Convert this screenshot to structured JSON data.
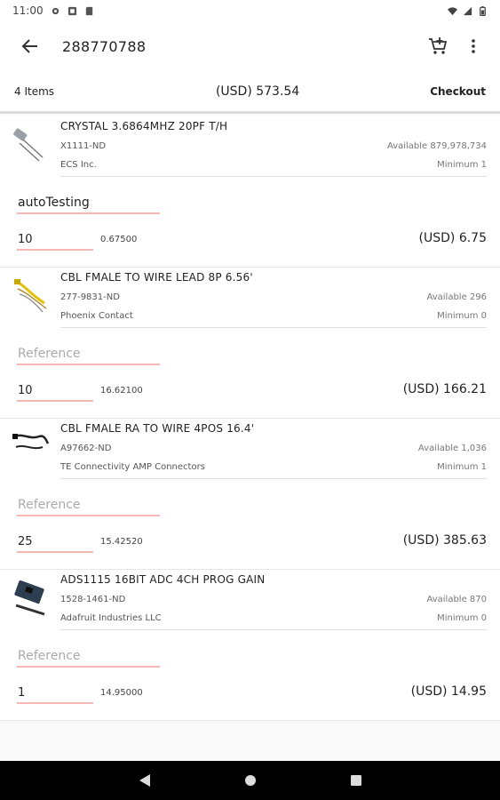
{
  "status": {
    "time": "11:00"
  },
  "app_bar": {
    "title": "288770788"
  },
  "summary": {
    "count": "4 Items",
    "total": "(USD) 573.54",
    "checkout_label": "Checkout"
  },
  "items": [
    {
      "name": "CRYSTAL 3.6864MHZ 20PF T/H",
      "part_number": "X1111-ND",
      "manufacturer": "ECS Inc.",
      "available": "Available 879,978,734",
      "minimum": "Minimum 1",
      "reference_value": "autoTesting",
      "reference_placeholder": "Reference",
      "quantity": "10",
      "unit_price": "0.67500",
      "extended_price": "(USD) 6.75",
      "thumb_icon": "crystal-oscillator-icon"
    },
    {
      "name": "CBL FMALE TO WIRE LEAD 8P 6.56'",
      "part_number": "277-9831-ND",
      "manufacturer": "Phoenix Contact",
      "available": "Available 296",
      "minimum": "Minimum 0",
      "reference_value": "",
      "reference_placeholder": "Reference",
      "quantity": "10",
      "unit_price": "16.62100",
      "extended_price": "(USD) 166.21",
      "thumb_icon": "cable-yellow-icon"
    },
    {
      "name": "CBL FMALE RA TO WIRE 4POS 16.4'",
      "part_number": "A97662-ND",
      "manufacturer": "TE Connectivity AMP Connectors",
      "available": "Available 1,036",
      "minimum": "Minimum 1",
      "reference_value": "",
      "reference_placeholder": "Reference",
      "quantity": "25",
      "unit_price": "15.42520",
      "extended_price": "(USD) 385.63",
      "thumb_icon": "cable-black-icon"
    },
    {
      "name": "ADS1115 16BIT ADC 4CH PROG GAIN",
      "part_number": "1528-1461-ND",
      "manufacturer": "Adafruit Industries LLC",
      "available": "Available 870",
      "minimum": "Minimum 0",
      "reference_value": "",
      "reference_placeholder": "Reference",
      "quantity": "1",
      "unit_price": "14.95000",
      "extended_price": "(USD) 14.95",
      "thumb_icon": "adc-board-icon"
    }
  ],
  "colors": {
    "field_underline": "#f4b9b4",
    "nav_bar": "#000000"
  }
}
